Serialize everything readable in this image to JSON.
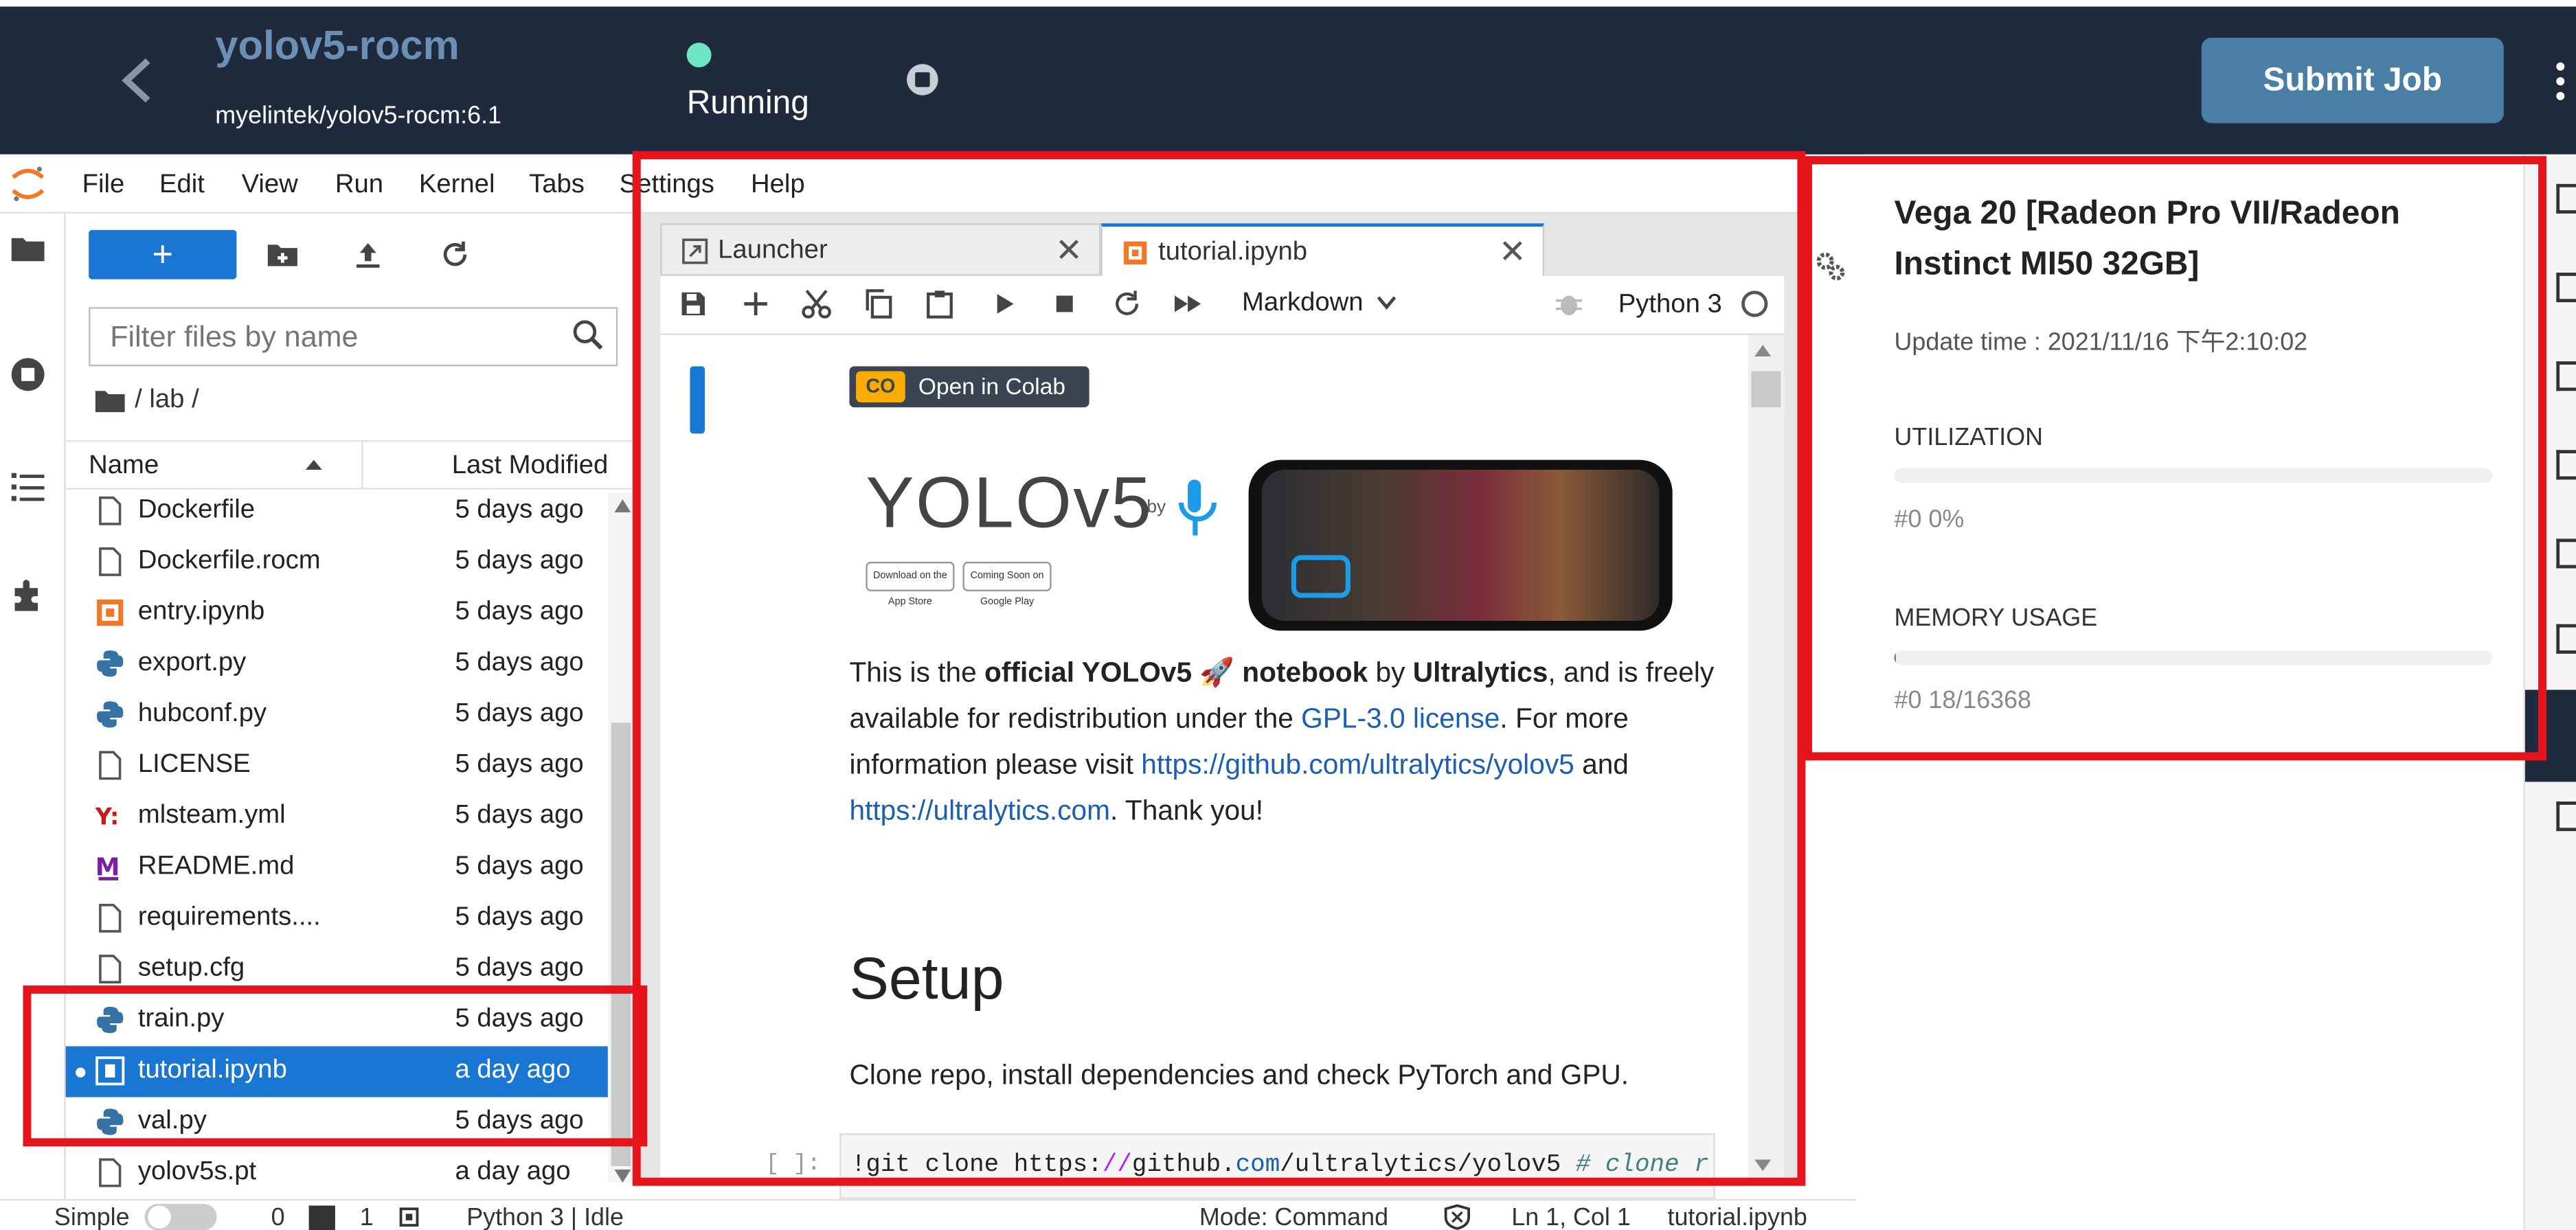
{
  "header": {
    "project_title": "yolov5-rocm",
    "project_image": "myelintek/yolov5-rocm:6.1",
    "status": "Running",
    "submit_label": "Submit Job",
    "status_color": "#6ee6c4",
    "accent": "#4b7ea5"
  },
  "menubar": {
    "items": [
      "File",
      "Edit",
      "View",
      "Run",
      "Kernel",
      "Tabs",
      "Settings",
      "Help"
    ]
  },
  "filebrowser": {
    "new_label": "+",
    "filter_placeholder": "Filter files by name",
    "breadcrumb": "/ lab /",
    "col_name": "Name",
    "col_modified": "Last Modified",
    "files": [
      {
        "name": "Dockerfile",
        "modified": "5 days ago",
        "icon": "file-icon"
      },
      {
        "name": "Dockerfile.rocm",
        "modified": "5 days ago",
        "icon": "file-icon"
      },
      {
        "name": "entry.ipynb",
        "modified": "5 days ago",
        "icon": "notebook-icon"
      },
      {
        "name": "export.py",
        "modified": "5 days ago",
        "icon": "python-icon"
      },
      {
        "name": "hubconf.py",
        "modified": "5 days ago",
        "icon": "python-icon"
      },
      {
        "name": "LICENSE",
        "modified": "5 days ago",
        "icon": "file-icon"
      },
      {
        "name": "mlsteam.yml",
        "modified": "5 days ago",
        "icon": "yaml-icon"
      },
      {
        "name": "README.md",
        "modified": "5 days ago",
        "icon": "markdown-icon"
      },
      {
        "name": "requirements....",
        "modified": "5 days ago",
        "icon": "file-icon"
      },
      {
        "name": "setup.cfg",
        "modified": "5 days ago",
        "icon": "file-icon"
      },
      {
        "name": "train.py",
        "modified": "5 days ago",
        "icon": "python-icon"
      },
      {
        "name": "tutorial.ipynb",
        "modified": "a day ago",
        "icon": "notebook-icon",
        "selected": true
      },
      {
        "name": "val.py",
        "modified": "5 days ago",
        "icon": "python-icon"
      },
      {
        "name": "yolov5s.pt",
        "modified": "a day ago",
        "icon": "file-icon"
      }
    ]
  },
  "tabs": [
    {
      "label": "Launcher",
      "icon": "launcher-icon"
    },
    {
      "label": "tutorial.ipynb",
      "icon": "notebook-icon",
      "active": true
    }
  ],
  "notebook_toolbar": {
    "cell_type": "Markdown",
    "kernel": "Python 3"
  },
  "notebook": {
    "colab_badge": "Open in Colab",
    "colab_co": "CO",
    "logo_text": "YOLOv5",
    "logo_by": "by",
    "badge_app_store": "Download on the App Store",
    "badge_google_play": "Coming Soon on Google Play",
    "para_1": "This is the ",
    "para_bold_1": "official YOLOv5 🚀 notebook",
    "para_2": " by ",
    "para_bold_2": "Ultralytics",
    "para_3": ", and is freely available for redistribution under the ",
    "para_link_1": "GPL-3.0 license",
    "para_4": ". For more information please visit ",
    "para_link_2": "https://github.com/ultralytics/yolov5",
    "para_5": " and ",
    "para_link_3": "https://ultralytics.com",
    "para_6": ". Thank you!",
    "setup_heading": "Setup",
    "setup_text": "Clone repo, install dependencies and check PyTorch and GPU.",
    "prompt": "[ ]:",
    "code_1": "!git clone https:",
    "code_slashes": "//",
    "code_2": "github.",
    "code_com": "com",
    "code_3": "/ultralytics",
    "code_4": "/yolov5  ",
    "code_comment": "# clone r"
  },
  "gpu_panel": {
    "title": "Vega 20 [Radeon Pro VII/Radeon Instinct MI50 32GB]",
    "update_time": "Update time : 2021/11/16 下午2:10:02",
    "utilization_label": "UTILIZATION",
    "utilization_value": "#0 0%",
    "utilization_fraction": 0.0,
    "memory_label": "MEMORY USAGE",
    "memory_value": "#0 18/16368",
    "memory_fraction": 0.0011
  },
  "statusbar": {
    "mode_toggle": "Simple",
    "count_1": "0",
    "count_2": "1",
    "kernel_status": "Python 3 | Idle",
    "mode": "Mode: Command",
    "cursor": "Ln 1, Col 1",
    "file": "tutorial.ipynb"
  }
}
